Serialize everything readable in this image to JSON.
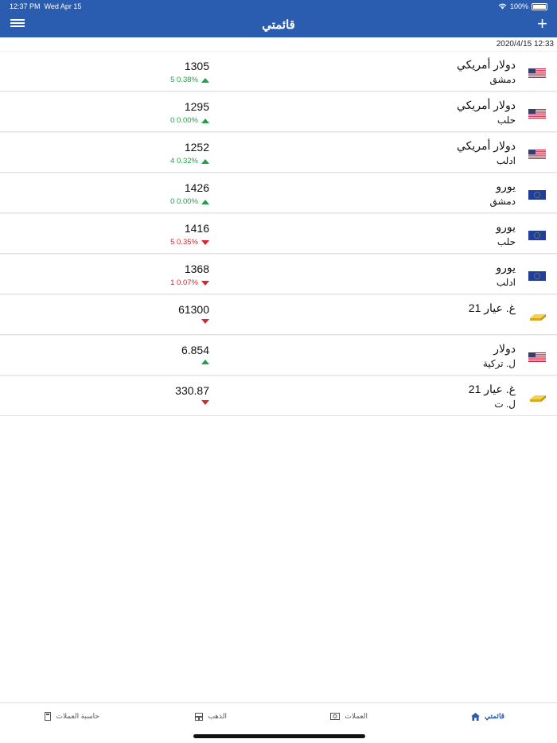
{
  "status": {
    "time": "12:37 PM",
    "date": "Wed Apr 15",
    "battery": "100%"
  },
  "header": {
    "title": "قائمتي"
  },
  "timestamp": "2020/4/15 12:33",
  "rows": [
    {
      "flag": "us-flag-icon",
      "name": "دولار أمريكي",
      "sub": "دمشق",
      "value": "1305",
      "change": "5 0.38%",
      "dir": "up"
    },
    {
      "flag": "us-flag-icon",
      "name": "دولار أمريكي",
      "sub": "حلب",
      "value": "1295",
      "change": "0 0.00%",
      "dir": "up"
    },
    {
      "flag": "us-flag-icon",
      "name": "دولار أمريكي",
      "sub": "ادلب",
      "value": "1252",
      "change": "4 0.32%",
      "dir": "up"
    },
    {
      "flag": "eu-flag-icon",
      "name": "يورو",
      "sub": "دمشق",
      "value": "1426",
      "change": "0 0.00%",
      "dir": "up"
    },
    {
      "flag": "eu-flag-icon",
      "name": "يورو",
      "sub": "حلب",
      "value": "1416",
      "change": "5 0.35%",
      "dir": "down"
    },
    {
      "flag": "eu-flag-icon",
      "name": "يورو",
      "sub": "ادلب",
      "value": "1368",
      "change": "1 0.07%",
      "dir": "down"
    },
    {
      "flag": "gold-bar-icon",
      "name": "غ. عيار 21",
      "sub": "",
      "value": "61300",
      "change": "",
      "dir": "down"
    },
    {
      "flag": "us-flag-icon",
      "name": "دولار",
      "sub": "ل. تركية",
      "value": "6.854",
      "change": "",
      "dir": "up"
    },
    {
      "flag": "gold-bar-icon",
      "name": "غ. عيار 21",
      "sub": "ل. ت",
      "value": "330.87",
      "change": "",
      "dir": "down"
    }
  ],
  "tabs": {
    "mylist": "قائمتي",
    "currencies": "العملات",
    "gold": "الذهب",
    "calculator": "حاسبة العملات"
  }
}
